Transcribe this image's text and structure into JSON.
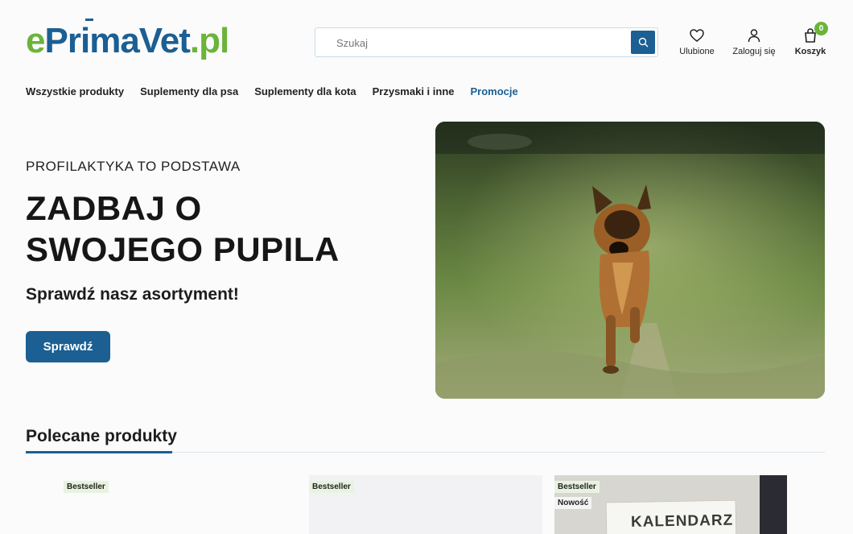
{
  "header": {
    "logo": {
      "part1": "e",
      "part2": "Pr",
      "part3": "i",
      "part4": "maVet",
      "part5": ".pl"
    },
    "search": {
      "placeholder": "Szukaj"
    },
    "favorites_label": "Ulubione",
    "login_label": "Zaloguj się",
    "cart_label": "Koszyk",
    "cart_count": "0"
  },
  "nav": {
    "items": [
      "Wszystkie produkty",
      "Suplementy dla psa",
      "Suplementy dla kota",
      "Przysmaki i inne",
      "Promocje"
    ]
  },
  "hero": {
    "kicker": "PROFILAKTYKA TO PODSTAWA",
    "title_line1": "ZADBAJ O",
    "title_line2": "SWOJEGO PUPILA",
    "subtitle": "Sprawdź nasz asortyment!",
    "button_label": "Sprawdź"
  },
  "products": {
    "section_title": "Polecane produkty",
    "cards": [
      {
        "badges": [
          "Bestseller"
        ]
      },
      {
        "badges": [
          "Bestseller"
        ]
      },
      {
        "badges": [
          "Bestseller",
          "Nowość"
        ],
        "image_text": "KALENDARZ"
      }
    ]
  },
  "colors": {
    "brand_blue": "#1b5f93",
    "brand_green": "#6bb43a"
  },
  "icons": {
    "search": "search-icon",
    "favorites": "heart-icon",
    "login": "user-icon",
    "cart": "bag-icon"
  }
}
